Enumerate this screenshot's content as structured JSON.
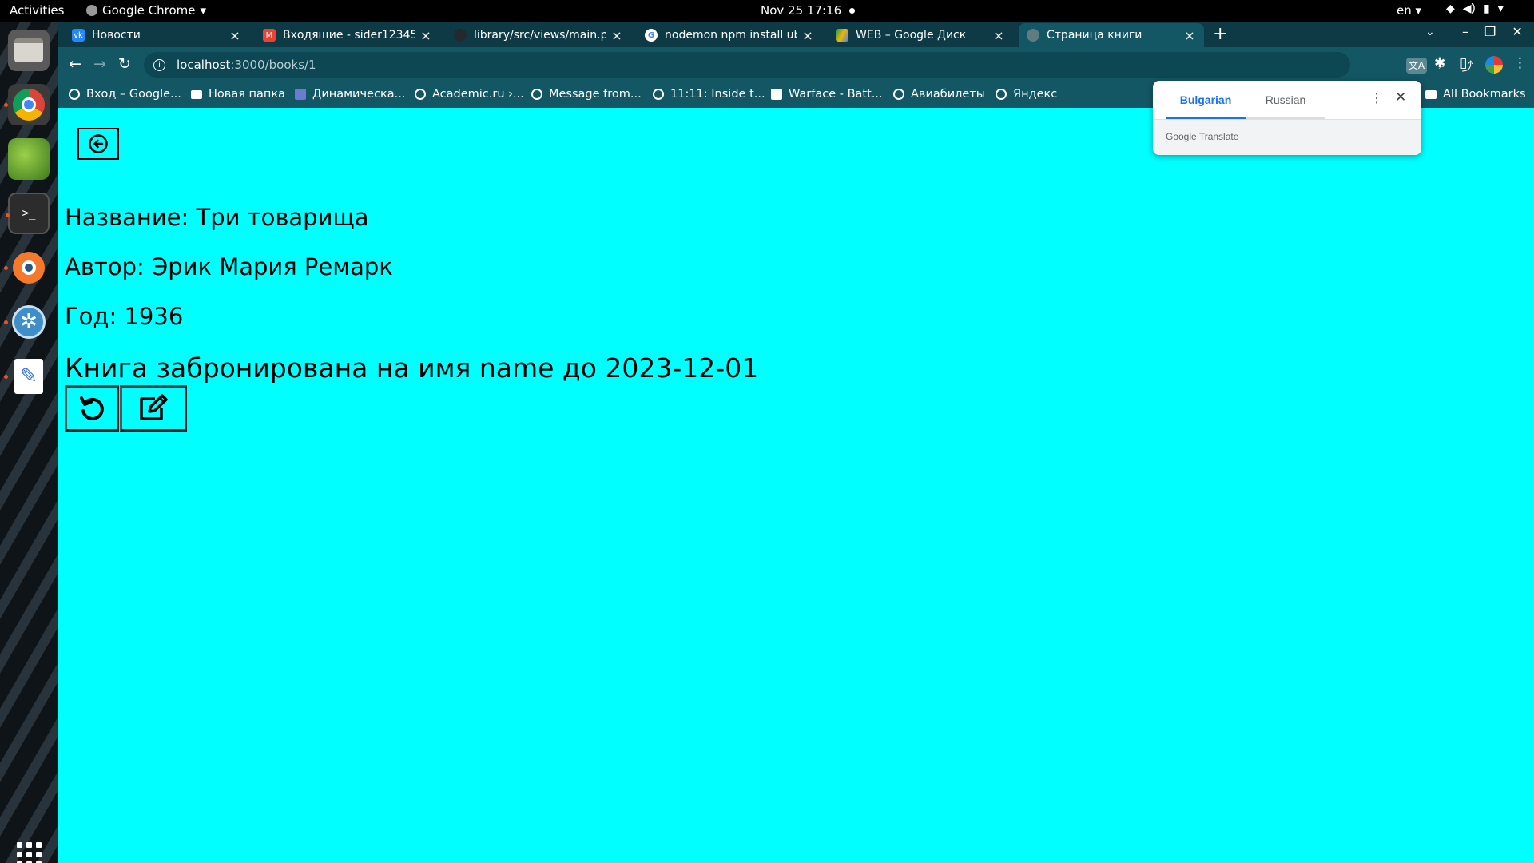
{
  "topbar": {
    "activities": "Activities",
    "app_name": "Google Chrome",
    "datetime": "Nov 25  17:16",
    "lang": "en"
  },
  "dock": {
    "items": [
      "files",
      "chrome",
      "image-viewer",
      "terminal",
      "blender",
      "kde-connect",
      "text-editor",
      "show-apps"
    ]
  },
  "browser": {
    "tabs": [
      {
        "title": "Новости",
        "favicon": "vk-icon",
        "color": "#2787f5"
      },
      {
        "title": "Входящие - sider123456",
        "favicon": "gmail-icon",
        "color": "#ea4335"
      },
      {
        "title": "library/src/views/main.p",
        "favicon": "github-icon",
        "color": "#24292f"
      },
      {
        "title": "nodemon npm install ub",
        "favicon": "google-icon",
        "color": "#4285f4"
      },
      {
        "title": "WEB – Google Диск",
        "favicon": "drive-icon",
        "color": "#0f9d58"
      },
      {
        "title": "Страница книги",
        "favicon": "globe-icon",
        "color": "#888888",
        "active": true
      }
    ],
    "url_host": "localhost",
    "url_path": ":3000/books/1",
    "bookmarks": [
      {
        "label": "Вход – Google...",
        "icon": "google-icon"
      },
      {
        "label": "Новая папка",
        "icon": "folder-icon"
      },
      {
        "label": "Динамическа...",
        "icon": "bookmark-page-icon"
      },
      {
        "label": "Academic.ru ›...",
        "icon": "globe-icon"
      },
      {
        "label": "Message from...",
        "icon": "globe-icon"
      },
      {
        "label": "11:11: Inside t...",
        "icon": "google-icon"
      },
      {
        "label": "Warface - Batt...",
        "icon": "warface-icon"
      },
      {
        "label": "Авиабилеты",
        "icon": "globe-icon"
      },
      {
        "label": "Яндекс",
        "icon": "globe-icon"
      }
    ],
    "all_bookmarks": "All Bookmarks"
  },
  "translate": {
    "source_lang": "Bulgarian",
    "target_lang": "Russian",
    "footer": "Google Translate"
  },
  "page": {
    "background": "#00ffff",
    "book": {
      "title_line": "Название: Три товарища",
      "author_line": "Автор: Эрик Мария Ремарк",
      "year_line": "Год: 1936",
      "reserved_line": "Книга забронирована на имя name до 2023-12-01"
    },
    "actions": [
      "return-icon",
      "edit-icon"
    ]
  }
}
